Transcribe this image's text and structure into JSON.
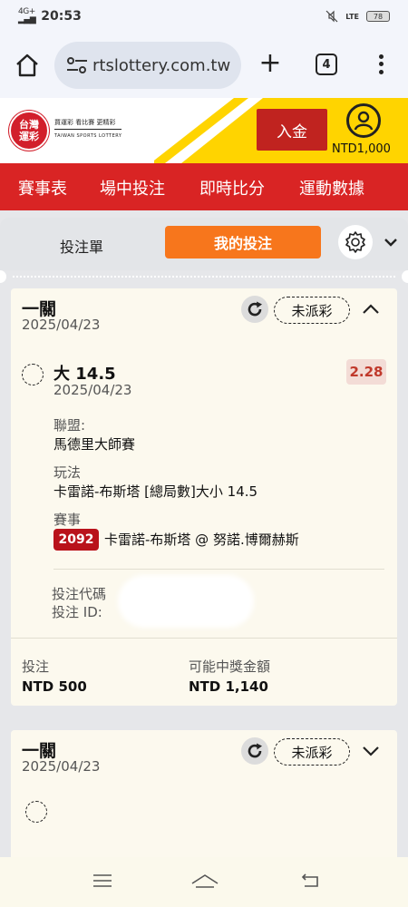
{
  "status_bar": {
    "network": "4G+",
    "time": "20:53",
    "battery": "78",
    "lte": "LTE"
  },
  "browser": {
    "url": "rtslottery.com.tw",
    "tab_count": "4"
  },
  "site": {
    "logo_text": "台灣\n運彩",
    "logo_tagline": "買運彩 看比賽 更精彩",
    "logo_english": "TAIWAN SPORTS LOTTERY",
    "deposit_label": "入金",
    "balance": "NTD1,000"
  },
  "nav": {
    "items": [
      "賽事表",
      "場中投注",
      "即時比分",
      "運動數據"
    ]
  },
  "slip_tabs": {
    "bet_slip": "投注單",
    "my_bets": "我的投注"
  },
  "bets": [
    {
      "type": "一關",
      "date": "2025/04/23",
      "status": "未派彩",
      "selection": "大 14.5",
      "selection_date": "2025/04/23",
      "odds": "2.28",
      "league_label": "聯盟:",
      "league": "馬德里大師賽",
      "market_label": "玩法",
      "market": "卡雷諾-布斯塔 [總局數]大小 14.5",
      "event_label": "賽事",
      "event_code": "2092",
      "event": "卡雷諾-布斯塔 @ 努諾.博爾赫斯",
      "bet_code_label": "投注代碼",
      "bet_id_label": "投注 ID: ",
      "stake_label": "投注",
      "stake": "NTD 500",
      "payout_label": "可能中獎金額",
      "payout": "NTD 1,140"
    },
    {
      "type": "一關",
      "date": "2025/04/23",
      "status": "未派彩"
    }
  ],
  "colors": {
    "brand_red": "#d92424",
    "deposit_red": "#c0231f",
    "accent_orange": "#f7761c",
    "yellow": "#ffd400",
    "card_bg": "#fcf9ee"
  }
}
